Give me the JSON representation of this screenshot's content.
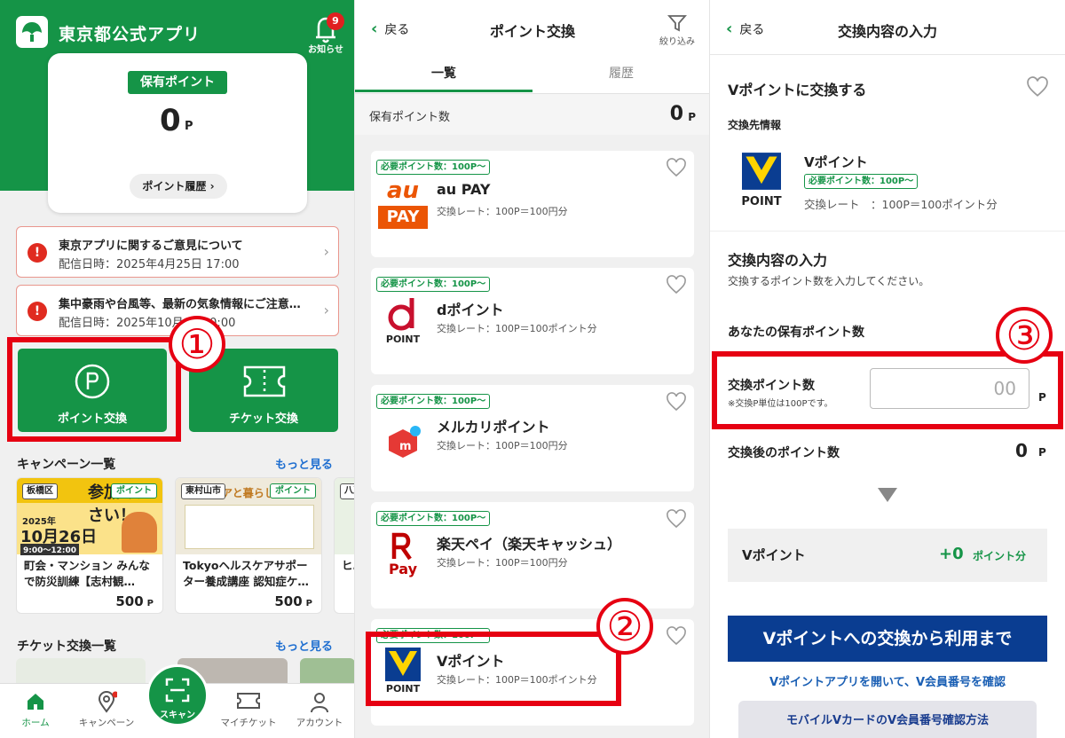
{
  "home": {
    "app_title": "東京都公式アプリ",
    "notice_badge": "9",
    "notice_label": "お知らせ",
    "points_label": "保有ポイント",
    "points_value": "0",
    "points_unit": "P",
    "history_button": "ポイント履歴",
    "messages": [
      {
        "title": "東京アプリに関するご意見について",
        "date": "配信日時：2025年4月25日 17:00"
      },
      {
        "title": "集中豪雨や台風等、最新の気象情報にご注意…",
        "date": "配信日時：2025年10月  日 00:00"
      }
    ],
    "tile_point_exchange": "ポイント交換",
    "tile_ticket_exchange": "チケット交換",
    "campaign_heading": "キャンペーン一覧",
    "ticket_heading": "チケット交換一覧",
    "more": "もっと見る",
    "campaigns": [
      {
        "area": "板橋区",
        "tag": "ポイント",
        "title": "町会・マンション みんなで防災訓練【志村観…",
        "points": "500",
        "unit": "P",
        "banner": "参加ください！",
        "date": "10月26日",
        "year": "2025年",
        "time": "9:00〜12:00",
        "accent": "#f2c40f"
      },
      {
        "area": "東村山市",
        "tag": "ポイント",
        "title": "Tokyoヘルスケアサポーター養成講座 認知症ケ…",
        "points": "500",
        "unit": "P",
        "banner": "ケアと暮らしの工夫",
        "accent": "#e8e3c9"
      },
      {
        "area": "八王",
        "title": "ヒ… ス…"
      }
    ],
    "nav": [
      {
        "label": "ホーム",
        "icon": "home-icon"
      },
      {
        "label": "キャンペーン",
        "icon": "map-pin-icon"
      },
      {
        "label": "スキャン",
        "icon": "scan-icon"
      },
      {
        "label": "マイチケット",
        "icon": "ticket-icon"
      },
      {
        "label": "アカウント",
        "icon": "account-icon"
      }
    ],
    "callout": "①"
  },
  "exchange": {
    "back": "戻る",
    "title": "ポイント交換",
    "filter": "絞り込み",
    "tabs": [
      "一覧",
      "履歴"
    ],
    "hold_label": "保有ポイント数",
    "hold_value": "0",
    "hold_unit": "P",
    "need_tag": "必要ポイント数：100P〜",
    "items": [
      {
        "name": "au PAY",
        "rate": "交換レート：100P＝100円分",
        "logo": "au-pay-logo"
      },
      {
        "name": "dポイント",
        "rate": "交換レート：100P＝100ポイント分",
        "logo": "d-point-logo"
      },
      {
        "name": "メルカリポイント",
        "rate": "交換レート：100P＝100円分",
        "logo": "mercari-logo"
      },
      {
        "name": "楽天ペイ（楽天キャッシュ）",
        "rate": "交換レート：100P＝100円分",
        "logo": "rakuten-pay-logo"
      },
      {
        "name": "Vポイント",
        "rate": "交換レート：100P＝100ポイント分",
        "logo": "v-point-logo"
      }
    ],
    "logo_text": {
      "au": "au",
      "pay": "PAY",
      "dpoint": "POINT",
      "rpay": "Pay",
      "vpoint": "POINT"
    },
    "callout": "②"
  },
  "input": {
    "back": "戻る",
    "title": "交換内容の入力",
    "heading": "Vポイントに交換する",
    "dest_label": "交換先情報",
    "dest_name": "Vポイント",
    "dest_need": "必要ポイント数：100P〜",
    "dest_rate": "交換レート　：100P＝100ポイント分",
    "section_title": "交換内容の入力",
    "section_desc": "交換するポイント数を入力してください。",
    "your_points": "あなたの保有ポイント数",
    "exchange_points": "交換ポイント数",
    "exchange_note": "※交換P単位は100Pです。",
    "input_placeholder": "00",
    "unit": "P",
    "after_label": "後のポイント数",
    "after_prefix": "交換",
    "after_value": "0",
    "v_label": "Vポイント",
    "v_value": "+0",
    "v_suffix": "ポイント分",
    "blue_banner": "Vポイントへの交換から利用まで",
    "link": "Vポイントアプリを開いて、V会員番号を確認",
    "gray_button": "モバイルVカードのV会員番号確認方法",
    "callout": "③"
  },
  "colors": {
    "brand_green": "#159447",
    "alert_red": "#e60012",
    "v_blue": "#0a3d91"
  }
}
